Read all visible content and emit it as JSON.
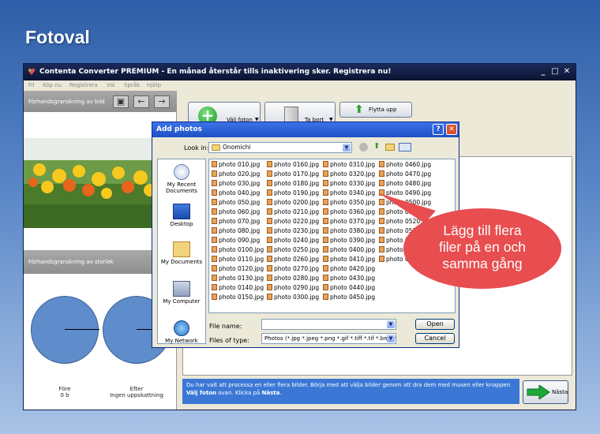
{
  "headline": "Fotoval",
  "window": {
    "title": "Contenta Converter PREMIUM  - En månad återstår tills inaktivering sker. Registrera nu!",
    "menu": [
      "Fil",
      "Köp nu",
      "Registrera",
      "Val",
      "Språk",
      "Hjälp"
    ]
  },
  "left_panel": {
    "image_preview_label": "Förhandsgranskning av bild",
    "size_preview_label": "Förhandsgranskning av storlek",
    "before_label": "Före",
    "before_value": "0 b",
    "after_label": "Efter",
    "after_value": "Ingen uppskattning"
  },
  "toolbar": {
    "choose_photos": "Välj foton",
    "remove": "Ta bort",
    "move_up": "Flytta upp"
  },
  "info": {
    "text_1": "Du har valt att processa en eller flera bilder. Börja med att välja bilder genom att dra dem med musen eller knappen ",
    "text_bold_1": "Välj foton",
    "text_2": " ovan. Klicka på ",
    "text_bold_2": "Nästa",
    "text_3": ".",
    "next_button": "Nästa"
  },
  "dialog": {
    "title": "Add photos",
    "help_btn": "?",
    "close_btn": "✕",
    "look_in_label": "Look in:",
    "look_in_value": "Onomichi",
    "places": [
      "My Recent Documents",
      "Desktop",
      "My Documents",
      "My Computer",
      "My Network"
    ],
    "columns": [
      [
        "photo 010.jpg",
        "photo 020.jpg",
        "photo 030.jpg",
        "photo 040.jpg",
        "photo 050.jpg",
        "photo 060.jpg",
        "photo 070.jpg",
        "photo 080.jpg",
        "photo 090.jpg",
        "photo 0100.jpg",
        "photo 0110.jpg",
        "photo 0120.jpg",
        "photo 0130.jpg",
        "photo 0140.jpg",
        "photo 0150.jpg"
      ],
      [
        "photo 0160.jpg",
        "photo 0170.jpg",
        "photo 0180.jpg",
        "photo 0190.jpg",
        "photo 0200.jpg",
        "photo 0210.jpg",
        "photo 0220.jpg",
        "photo 0230.jpg",
        "photo 0240.jpg",
        "photo 0250.jpg",
        "photo 0260.jpg",
        "photo 0270.jpg",
        "photo 0280.jpg",
        "photo 0290.jpg",
        "photo 0300.jpg"
      ],
      [
        "photo 0310.jpg",
        "photo 0320.jpg",
        "photo 0330.jpg",
        "photo 0340.jpg",
        "photo 0350.jpg",
        "photo 0360.jpg",
        "photo 0370.jpg",
        "photo 0380.jpg",
        "photo 0390.jpg",
        "photo 0400.jpg",
        "photo 0410.jpg",
        "photo 0420.jpg",
        "photo 0430.jpg",
        "photo 0440.jpg",
        "photo 0450.jpg"
      ],
      [
        "photo 0460.jpg",
        "photo 0470.jpg",
        "photo 0480.jpg",
        "photo 0490.jpg",
        "photo 0500.jpg",
        "photo 0510.jpg",
        "photo 0520.jpg",
        "photo 0530.jpg",
        "photo 0540.jpg",
        "photo 0550.jpg",
        "photo 0560.jpg"
      ]
    ],
    "file_name_label": "File name:",
    "file_name_value": "",
    "file_type_label": "Files of type:",
    "file_type_value": "Photos (*.jpg *.jpeg *.png *.gif *.tiff *.tif *.bmp *.jp",
    "open_button": "Open",
    "cancel_button": "Cancel"
  },
  "callout": [
    "Lägg till flera",
    "filer på en och",
    "samma gång"
  ],
  "colors": {
    "background_top": "#2e5ea8",
    "title_bar": "#0a1431",
    "info_bar": "#3b78d6",
    "callout": "#e84d4f",
    "pie": "#5f8ccb"
  }
}
